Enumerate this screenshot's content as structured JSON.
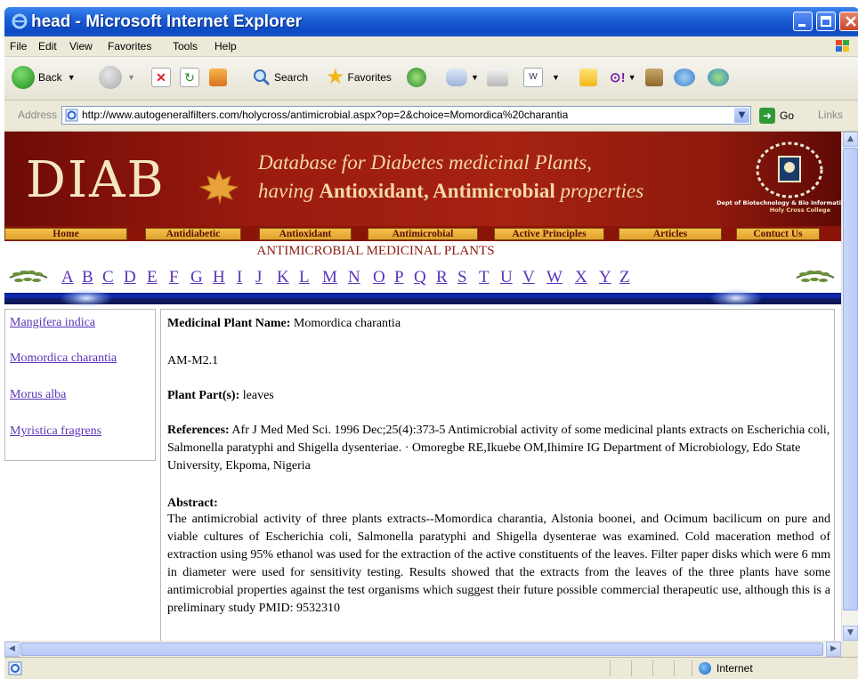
{
  "window": {
    "title": "head - Microsoft Internet Explorer"
  },
  "menu": [
    "File",
    "Edit",
    "View",
    "Favorites",
    "Tools",
    "Help"
  ],
  "toolbar": {
    "back": "Back",
    "search": "Search",
    "favorites": "Favorites"
  },
  "address": {
    "label": "Address",
    "url": "http://www.autogeneralfilters.com/holycross/antimicrobial.aspx?op=2&choice=Momordica%20charantia",
    "go": "Go",
    "links": "Links"
  },
  "banner": {
    "logo": "DIAB",
    "tagline1": "Database for Diabetes medicinal Plants,",
    "tagline2_prefix": "having ",
    "tagline2_bold": "Antioxidant, Antimicrobial",
    "tagline2_suffix": " properties",
    "dept": "Dept of Biotechnology & Bio Informati",
    "college": "Holy Cross College"
  },
  "nav": [
    "Home",
    "Antidiabetic",
    "Antioxidant",
    "Antimicrobial",
    "Active Principles",
    "Articles",
    "Contuct Us"
  ],
  "heading": "ANTIMICROBIAL MEDICINAL PLANTS",
  "alphabet": [
    "A",
    "B",
    "C",
    "D",
    "E",
    "F",
    "G",
    "H",
    "I",
    "J",
    "K",
    "L",
    "M",
    "N",
    "O",
    "P",
    "Q",
    "R",
    "S",
    "T",
    "U",
    "V",
    "W",
    "X",
    "Y",
    "Z"
  ],
  "plants": [
    "Mangifera indica",
    "Momordica charantia",
    "Morus alba",
    "Myristica fragrens"
  ],
  "detail": {
    "name_label": "Medicinal Plant Name:",
    "name_value": " Momordica charantia",
    "code": "AM-M2.1",
    "part_label": "Plant Part(s):",
    "part_value": " leaves",
    "ref_label": "References:",
    "ref_value": " Afr J Med Med Sci. 1996 Dec;25(4):373-5 Antimicrobial activity of some medicinal plants extracts on Escherichia coli, Salmonella paratyphi and Shigella dysenteriae. · Omoregbe RE,Ikuebe OM,Ihimire IG Department of Microbiology, Edo State University, Ekpoma, Nigeria",
    "abstract_label": "Abstract:",
    "abstract_text": "The antimicrobial activity of three plants extracts--Momordica charantia, Alstonia boonei, and Ocimum bacilicum on pure and viable cultures of Escherichia coli, Salmonella paratyphi and Shigella dysenterae was examined. Cold maceration method of extraction using 95% ethanol was used for the extraction of the active constituents of the leaves. Filter paper disks which were 6 mm in diameter were used for sensitivity testing. Results showed that the extracts from the leaves of the three plants have some antimicrobial properties against the test organisms which suggest their future possible commercial therapeutic use, although this is a preliminary study PMID: 9532310"
  },
  "status": {
    "zone": "Internet"
  },
  "colors": {
    "titlebar": "#1d5fd6",
    "banner": "#9b1b0f",
    "link": "#5a34b8",
    "heading": "#8a1c10"
  }
}
